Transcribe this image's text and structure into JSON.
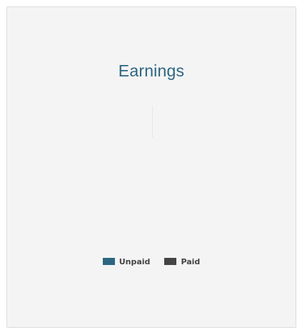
{
  "card": {
    "title": "Earnings"
  },
  "chart_data": {
    "type": "pie",
    "series": [
      {
        "name": "Unpaid",
        "color": "#2d6680",
        "values": []
      },
      {
        "name": "Paid",
        "color": "#444444",
        "values": []
      }
    ],
    "legend": "bottom"
  },
  "legend": {
    "items": [
      {
        "label": "Unpaid",
        "color": "#2d6680"
      },
      {
        "label": "Paid",
        "color": "#444444"
      }
    ]
  }
}
